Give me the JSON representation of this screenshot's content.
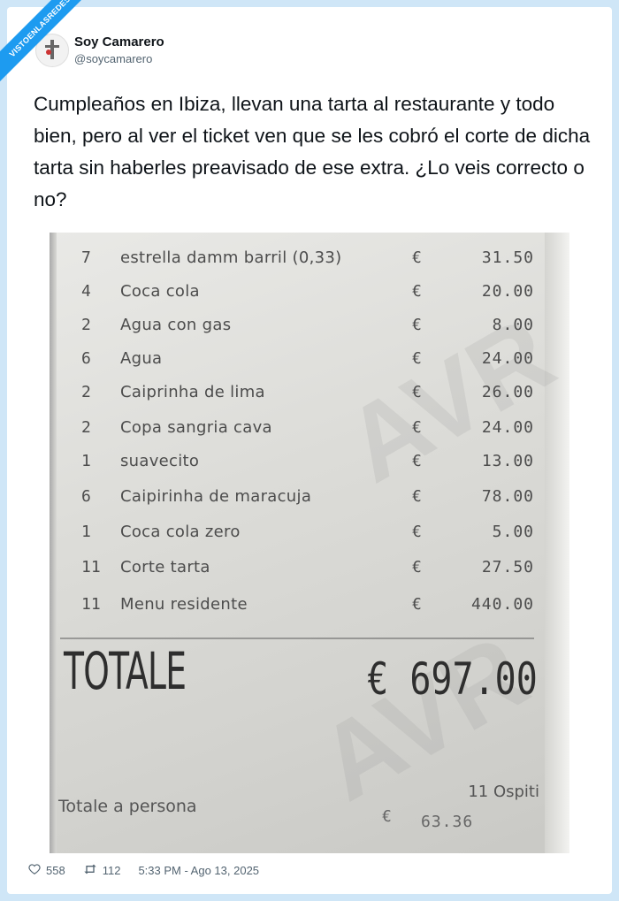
{
  "watermark": "VISTOENLASREDES",
  "author": {
    "name": "Soy Camarero",
    "handle": "@soycamarero"
  },
  "tweet": {
    "text": "Cumpleaños en Ibiza, llevan una tarta al restaurante y todo bien, pero al ver el ticket ven que se les cobró el corte de dicha tarta sin haberles preavisado de ese extra. ¿Lo veis correcto o no?"
  },
  "receipt": {
    "currency": "€",
    "items": [
      {
        "qty": "7",
        "desc": "estrella damm barril (0,33)",
        "amount": "31.50"
      },
      {
        "qty": "4",
        "desc": "Coca cola",
        "amount": "20.00"
      },
      {
        "qty": "2",
        "desc": "Agua con gas",
        "amount": "8.00"
      },
      {
        "qty": "6",
        "desc": "Agua",
        "amount": "24.00"
      },
      {
        "qty": "2",
        "desc": "Caiprinha de lima",
        "amount": "26.00"
      },
      {
        "qty": "2",
        "desc": "Copa sangria cava",
        "amount": "24.00"
      },
      {
        "qty": "1",
        "desc": "suavecito",
        "amount": "13.00"
      },
      {
        "qty": "6",
        "desc": "Caipirinha de maracuja",
        "amount": "78.00"
      },
      {
        "qty": "1",
        "desc": "Coca cola zero",
        "amount": "5.00"
      },
      {
        "qty": "11",
        "desc": "Corte tarta",
        "amount": "27.50"
      },
      {
        "qty": "11",
        "desc": "Menu residente",
        "amount": "440.00"
      }
    ],
    "total_label": "TOTALE",
    "total_value": "€ 697.00",
    "guests": "11 Ospiti",
    "per_person_label": "Totale a persona",
    "per_person_amount": "63.36"
  },
  "footer": {
    "likes": "558",
    "retweets": "112",
    "timestamp": "5:33 PM - Ago 13, 2025",
    "like_icon": "heart-icon",
    "retweet_icon": "retweet-icon"
  }
}
